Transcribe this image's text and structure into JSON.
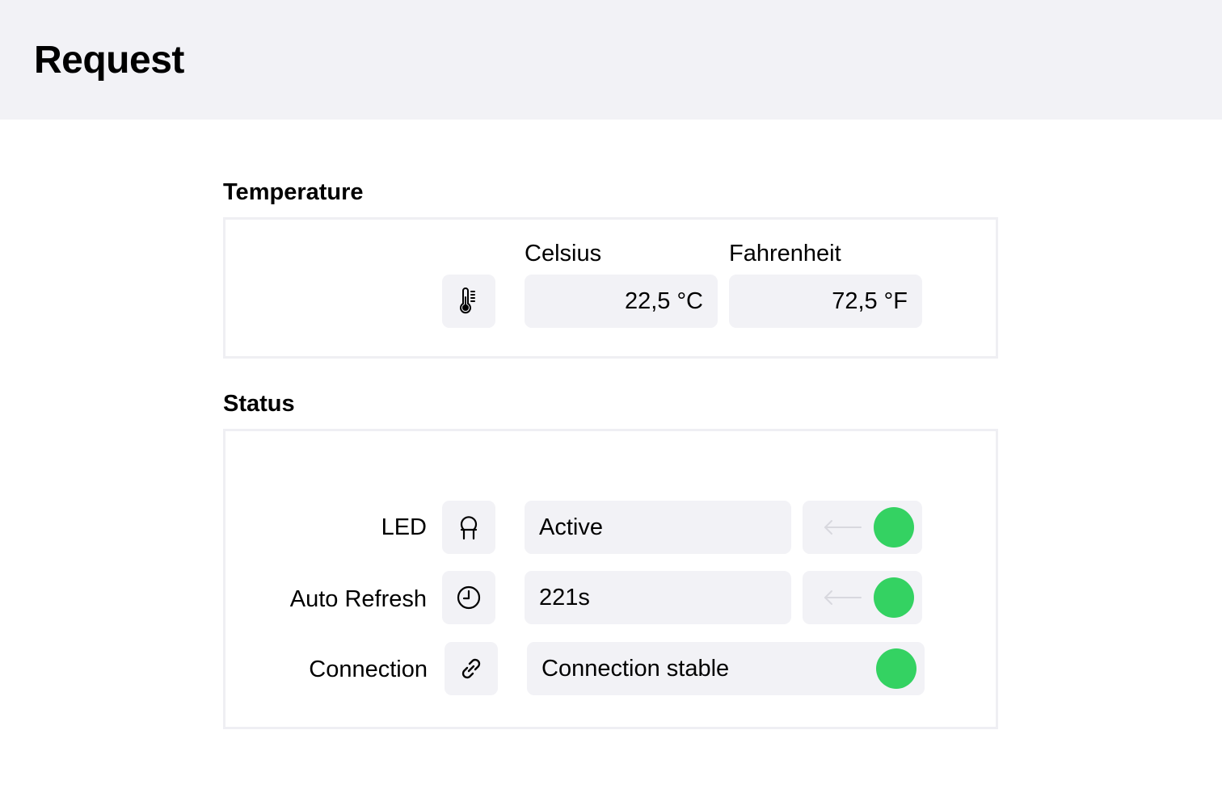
{
  "header": {
    "title": "Request"
  },
  "temperature": {
    "section_title": "Temperature",
    "icon": "thermometer-icon",
    "celsius_label": "Celsius",
    "fahrenheit_label": "Fahrenheit",
    "celsius_value": "22,5 °C",
    "fahrenheit_value": "72,5 °F"
  },
  "status": {
    "section_title": "Status",
    "rows": [
      {
        "label": "LED",
        "icon": "led-icon",
        "value": "Active",
        "toggle_on": true
      },
      {
        "label": "Auto Refresh",
        "icon": "clock-icon",
        "value": "221s",
        "toggle_on": true
      },
      {
        "label": "Connection",
        "icon": "link-icon",
        "value": "Connection stable",
        "indicator_on": true
      }
    ]
  },
  "colors": {
    "accent_green": "#34d262",
    "surface": "#f2f2f6"
  }
}
